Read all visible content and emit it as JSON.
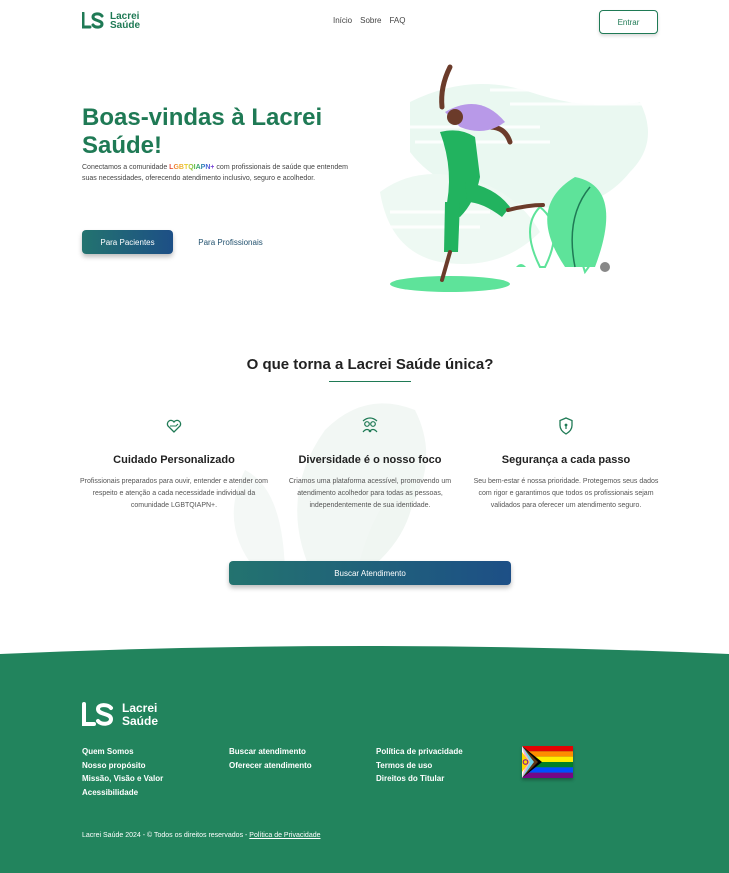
{
  "header": {
    "logo_line1": "Lacrei",
    "logo_line2": "Saúde",
    "nav": [
      "Início",
      "Sobre",
      "FAQ"
    ],
    "login_label": "Entrar"
  },
  "hero": {
    "title": "Boas-vindas à Lacrei Saúde!",
    "desc_before": "Conectamos a comunidade ",
    "desc_highlight": "LGBTQIAPN+",
    "desc_after": " com profissionais de saúde que entendem suas necessidades, oferecendo atendimento inclusivo, seguro e acolhedor.",
    "btn_patients": "Para Pacientes",
    "btn_professionals": "Para Profissionais"
  },
  "features": {
    "title": "O que torna a Lacrei Saúde única?",
    "items": [
      {
        "icon": "heart-hands-icon",
        "title": "Cuidado Personalizado",
        "desc": "Profissionais preparados para ouvir, entender e atender com respeito e atenção a cada necessidade individual da comunidade LGBTQIAPN+."
      },
      {
        "icon": "people-icon",
        "title": "Diversidade é o nosso foco",
        "desc": "Criamos uma plataforma acessível, promovendo um atendimento acolhedor para todas as pessoas, independentemente de sua identidade."
      },
      {
        "icon": "shield-icon",
        "title": "Segurança a cada passo",
        "desc": "Seu bem-estar é nossa prioridade. Protegemos seus dados com rigor e garantimos que todos os profissionais sejam validados para oferecer um atendimento seguro."
      }
    ],
    "cta": "Buscar Atendimento"
  },
  "footer": {
    "logo_line1": "Lacrei",
    "logo_line2": "Saúde",
    "col1": [
      "Quem Somos",
      "Nosso propósito",
      "Missão, Visão e Valor",
      "Acessibilidade"
    ],
    "col2": [
      "Buscar atendimento",
      "Oferecer atendimento"
    ],
    "col3": [
      "Política de privacidade",
      "Termos de uso",
      "Direitos do Titular"
    ],
    "copyright": "Lacrei Saúde 2024 - © Todos os direitos reservados - ",
    "policy_link": "Política de Privacidade"
  },
  "colors": {
    "brand_green": "#1f7a55",
    "footer_green": "#22845d",
    "button_gradient_start": "#23736f",
    "button_gradient_end": "#1d4f86",
    "mint": "#e6f7f0"
  }
}
